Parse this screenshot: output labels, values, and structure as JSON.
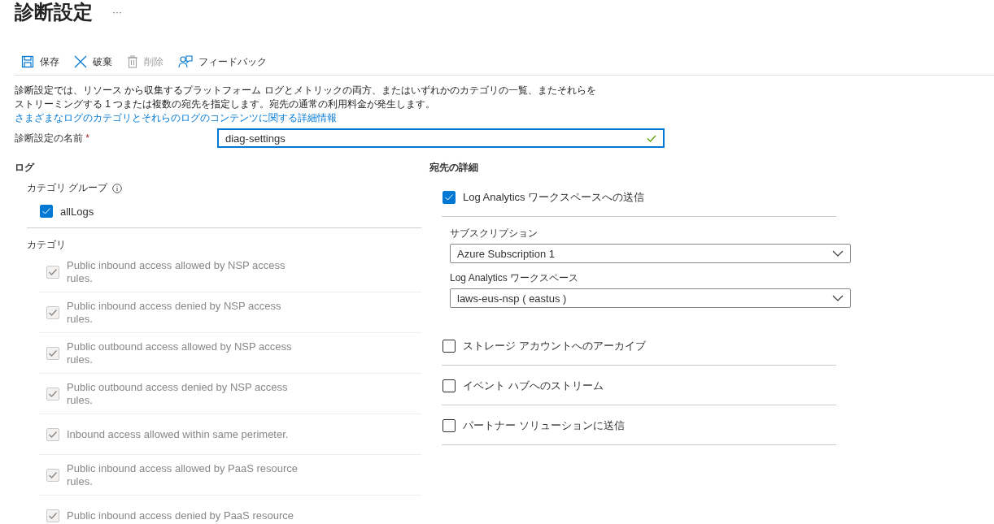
{
  "page": {
    "title": "診断設定",
    "more": "···"
  },
  "toolbar": [
    {
      "label": "保存",
      "kind": "save",
      "disabled": false
    },
    {
      "label": "破棄",
      "kind": "discard",
      "disabled": false
    },
    {
      "label": "削除",
      "kind": "delete",
      "disabled": true
    },
    {
      "label": "フィードバック",
      "kind": "feedback",
      "disabled": false
    }
  ],
  "description": {
    "text": "診断設定では、リソース から収集するプラットフォーム ログとメトリックの両方、またはいずれかのカテゴリの一覧、またそれらをストリーミングする 1 つまたは複数の宛先を指定します。宛先の通常の利用料金が発生します。",
    "link": "さまざまなログのカテゴリとそれらのログのコンテンツに関する詳細情報"
  },
  "name_field": {
    "label": "診断設定の名前",
    "required_mark": "*",
    "value": "diag-settings",
    "valid": true
  },
  "logs": {
    "heading": "ログ",
    "group_label": "カテゴリ グループ",
    "groups": [
      {
        "label": "allLogs",
        "checked": true
      }
    ],
    "category_label": "カテゴリ",
    "categories": [
      {
        "label": "Public inbound access allowed by NSP access rules.",
        "checked": true,
        "disabled": true
      },
      {
        "label": "Public inbound access denied by NSP access rules.",
        "checked": true,
        "disabled": true
      },
      {
        "label": "Public outbound access allowed by NSP access rules.",
        "checked": true,
        "disabled": true
      },
      {
        "label": "Public outbound access denied by NSP access rules.",
        "checked": true,
        "disabled": true
      },
      {
        "label": "Inbound access allowed within same perimeter.",
        "checked": true,
        "disabled": true
      },
      {
        "label": "Public inbound access allowed by PaaS resource rules.",
        "checked": true,
        "disabled": true
      },
      {
        "label": "Public inbound access denied by PaaS resource",
        "checked": true,
        "disabled": true
      }
    ]
  },
  "destination": {
    "heading": "宛先の詳細",
    "options": [
      {
        "label": "Log Analytics ワークスペースへの送信",
        "checked": true,
        "fields": [
          {
            "label": "サブスクリプション",
            "value": "Azure Subscription 1"
          },
          {
            "label": "Log Analytics ワークスペース",
            "value": "laws-eus-nsp ( eastus )"
          }
        ]
      },
      {
        "label": "ストレージ アカウントへのアーカイブ",
        "checked": false
      },
      {
        "label": "イベント ハブへのストリーム",
        "checked": false
      },
      {
        "label": "パートナー ソリューションに送信",
        "checked": false
      }
    ]
  }
}
